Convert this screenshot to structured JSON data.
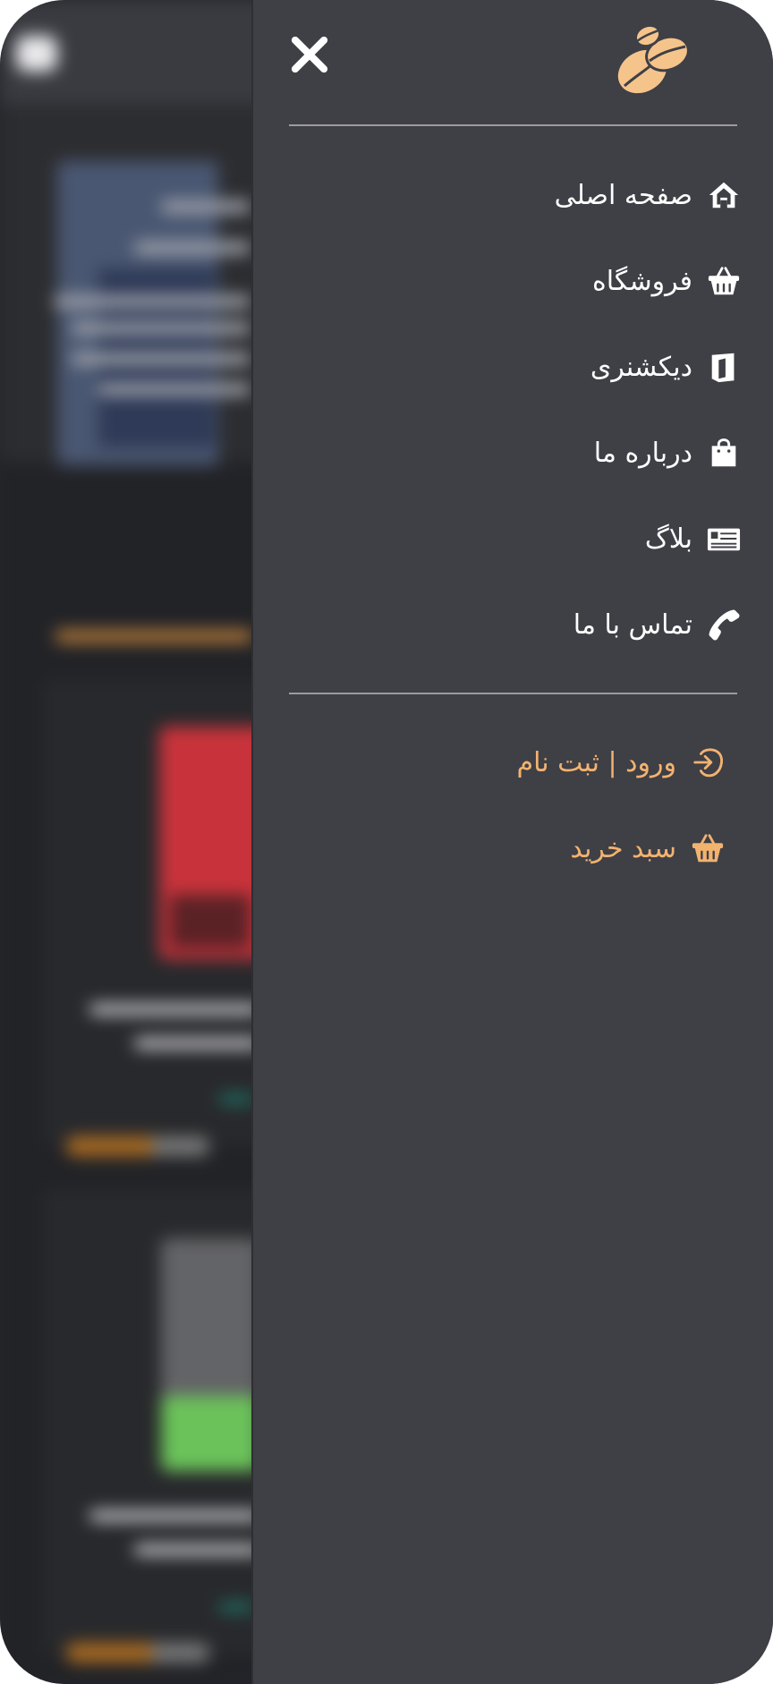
{
  "drawer": {
    "menu_items": [
      {
        "label": "صفحه اصلی",
        "icon": "home-icon"
      },
      {
        "label": "فروشگاه",
        "icon": "basket-icon"
      },
      {
        "label": "دیکشنری",
        "icon": "dictionary-icon"
      },
      {
        "label": "درباره ما",
        "icon": "shopping-bag-icon"
      },
      {
        "label": "بلاگ",
        "icon": "newspaper-icon"
      },
      {
        "label": "تماس با ما",
        "icon": "phone-icon"
      }
    ],
    "actions": [
      {
        "label": "ورود | ثبت نام",
        "icon": "login-icon"
      },
      {
        "label": "سبد خرید",
        "icon": "cart-basket-icon"
      }
    ]
  },
  "colors": {
    "drawer_bg": "#3f3f46",
    "menu_text": "#ffffff",
    "accent": "#f2b36f",
    "divider": "#9a9aa0"
  }
}
